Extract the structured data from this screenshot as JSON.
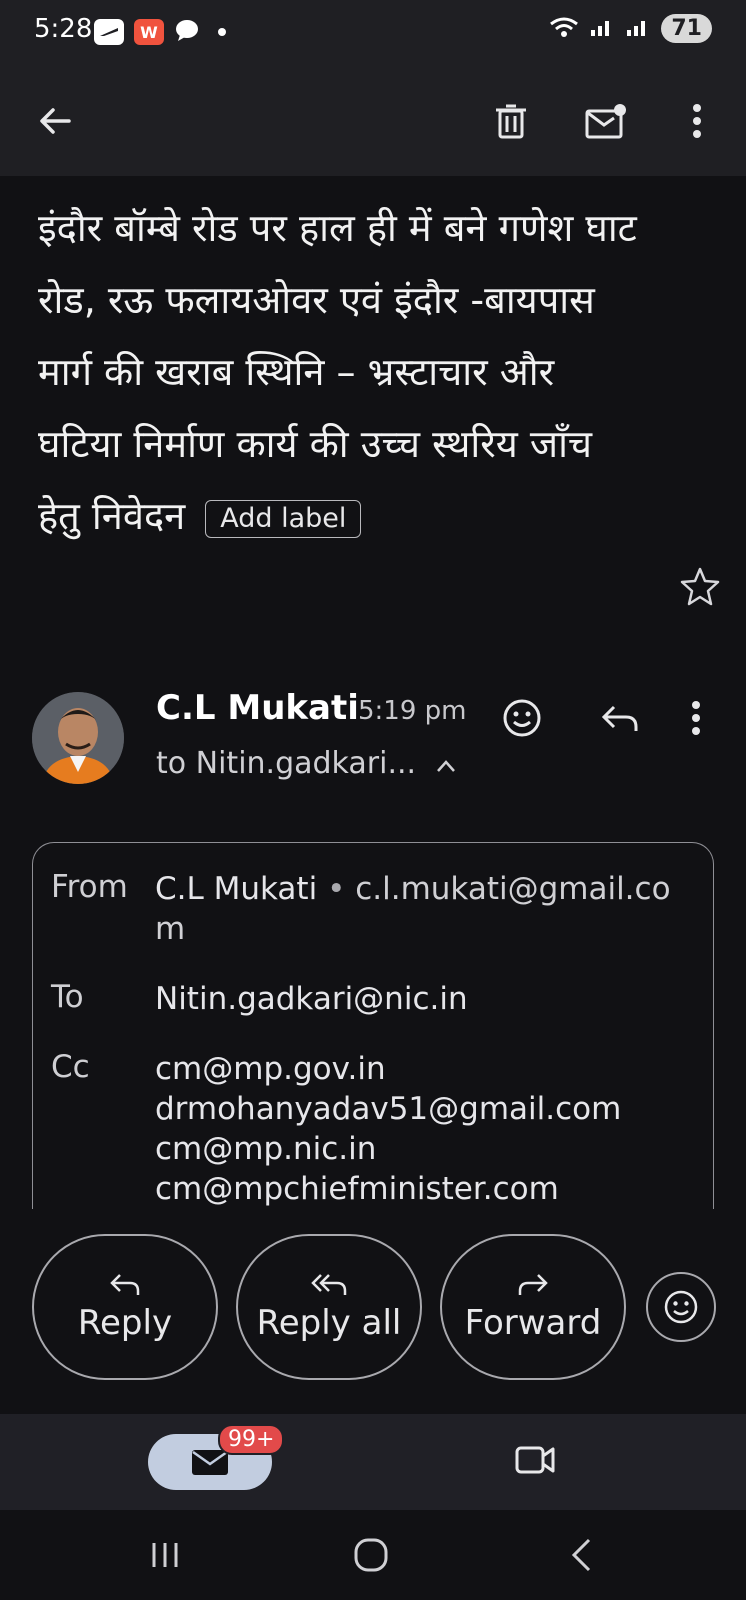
{
  "status_bar": {
    "time": "5:28",
    "battery": "71"
  },
  "toolbar": {
    "back_icon": "arrow-left-icon",
    "delete_icon": "trash-icon",
    "mark_unread_icon": "mail-unread-icon",
    "more_icon": "more-vertical-icon"
  },
  "email": {
    "subject": " इंदौर बॉम्बे रोड पर हाल ही में बने गणेश घाट रोड, रऊ फलायओवर एवं इंदौर -बायपास मार्ग की खराब स्थिनि – भ्रस्टाचार और घटिया निर्माण कार्य की उच्च स्थरिय जाँच हेतु निवेदन",
    "add_label": "Add label",
    "sender_name": "C.L Mukati",
    "sent_time": "5:19 pm",
    "recipients_summary": "to Nitin.gadkari...",
    "details": {
      "from_label": "From",
      "from_name": "C.L Mukati",
      "from_email": "c.l.mukati@gmail.com",
      "to_label": "To",
      "to_value": "Nitin.gadkari@nic.in",
      "cc_label": "Cc",
      "cc_values": [
        "cm@mp.gov.in",
        "drmohanyadav51@gmail.com",
        "cm@mp.nic.in",
        "cm@mpchiefminister.com"
      ]
    }
  },
  "actions": {
    "reply": "Reply",
    "reply_all": "Reply all",
    "forward": "Forward"
  },
  "bottom_nav": {
    "mail_badge": "99+"
  },
  "colors": {
    "background": "#111114",
    "bar": "#1f1f23",
    "mail_pill": "#c2cde0",
    "badge": "#e24a4a"
  }
}
